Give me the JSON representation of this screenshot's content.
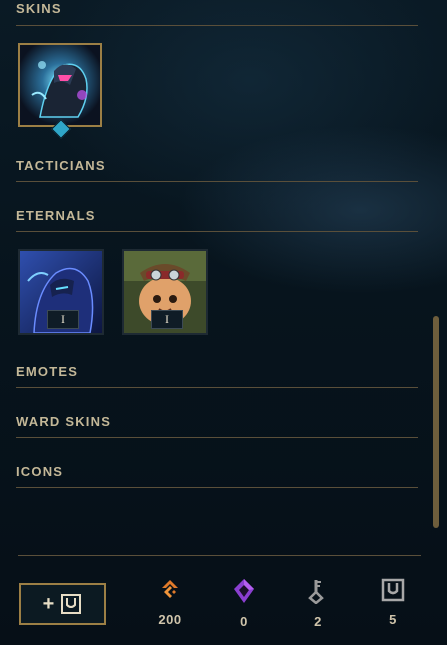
{
  "sections": {
    "skins": "SKINS",
    "tacticians": "TACTICIANS",
    "eternals": "ETERNALS",
    "emotes": "EMOTES",
    "ward_skins": "WARD SKINS",
    "icons": "ICONS"
  },
  "eternals": [
    {
      "badge": "I",
      "icon": "champion-portrait-blue-icon"
    },
    {
      "badge": "I",
      "icon": "teemo-portrait-icon"
    }
  ],
  "footer": {
    "add_button_label": "+",
    "currencies": [
      {
        "icon": "orange-essence-icon",
        "value": "200",
        "color": "#e07a2a"
      },
      {
        "icon": "mythic-essence-icon",
        "value": "0",
        "color": "#a34fe0"
      },
      {
        "icon": "key-icon",
        "value": "2",
        "color": "#8e8e8e"
      },
      {
        "icon": "chest-icon",
        "value": "5",
        "color": "#a8a8a8"
      }
    ]
  },
  "colors": {
    "accent_gold": "#9c7f45",
    "title": "#c4b898",
    "background": "#07141d"
  }
}
